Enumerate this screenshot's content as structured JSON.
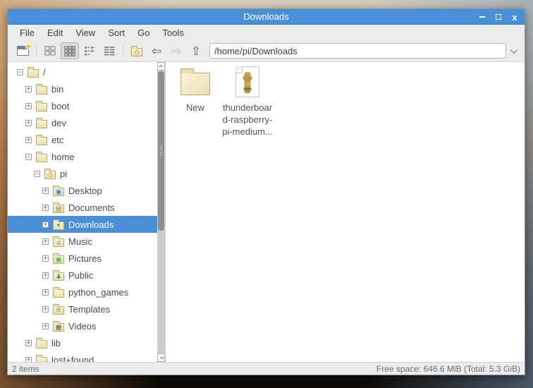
{
  "window": {
    "title": "Downloads",
    "controls": {
      "minimize": "minimize",
      "maximize": "maximize",
      "close": "x"
    }
  },
  "menu_bar": {
    "items": [
      "File",
      "Edit",
      "View",
      "Sort",
      "Go",
      "Tools"
    ]
  },
  "toolbar": {
    "buttons": [
      "new-window",
      "icon-view",
      "thumbnail-view",
      "compact-view",
      "detailed-list-view",
      "home",
      "back",
      "forward",
      "up"
    ],
    "active_view": "thumbnail-view",
    "back_glyph": "⇦",
    "forward_glyph": "⇨",
    "up_glyph": "⇧",
    "home_overlay_glyph": "⌂",
    "path": {
      "value": "/home/pi/Downloads"
    }
  },
  "sidebar": {
    "tree": [
      {
        "label": "/",
        "level": 0,
        "expander": "−",
        "icon": "folder",
        "glyph": ""
      },
      {
        "label": "bin",
        "level": 1,
        "expander": "+",
        "icon": "folder",
        "glyph": ""
      },
      {
        "label": "boot",
        "level": 1,
        "expander": "+",
        "icon": "folder",
        "glyph": ""
      },
      {
        "label": "dev",
        "level": 1,
        "expander": "+",
        "icon": "folder",
        "glyph": ""
      },
      {
        "label": "etc",
        "level": 1,
        "expander": "+",
        "icon": "folder",
        "glyph": ""
      },
      {
        "label": "home",
        "level": 1,
        "expander": "−",
        "icon": "folder",
        "glyph": ""
      },
      {
        "label": "pi",
        "level": 2,
        "expander": "−",
        "icon": "home-folder",
        "glyph": "⌂"
      },
      {
        "label": "Desktop",
        "level": 3,
        "expander": "+",
        "icon": "desktop-folder",
        "glyph": "▣"
      },
      {
        "label": "Documents",
        "level": 3,
        "expander": "+",
        "icon": "documents-folder",
        "glyph": "▤"
      },
      {
        "label": "Downloads",
        "level": 3,
        "expander": "+",
        "icon": "downloads-folder",
        "glyph": "▼",
        "selected": true
      },
      {
        "label": "Music",
        "level": 3,
        "expander": "+",
        "icon": "music-folder",
        "glyph": "♫"
      },
      {
        "label": "Pictures",
        "level": 3,
        "expander": "+",
        "icon": "pictures-folder",
        "glyph": "▣"
      },
      {
        "label": "Public",
        "level": 3,
        "expander": "+",
        "icon": "public-folder",
        "glyph": "♟"
      },
      {
        "label": "python_games",
        "level": 3,
        "expander": "+",
        "icon": "folder",
        "glyph": ""
      },
      {
        "label": "Templates",
        "level": 3,
        "expander": "+",
        "icon": "templates-folder",
        "glyph": "≡"
      },
      {
        "label": "Videos",
        "level": 3,
        "expander": "+",
        "icon": "videos-folder",
        "glyph": "▦"
      },
      {
        "label": "lib",
        "level": 1,
        "expander": "+",
        "icon": "folder",
        "glyph": ""
      },
      {
        "label": "lost+found",
        "level": 1,
        "expander": "+",
        "icon": "folder",
        "glyph": ""
      }
    ]
  },
  "main": {
    "items": [
      {
        "label": "New",
        "icon": "folder"
      },
      {
        "label": "thunderboar\nd-raspberry-\npi-medium...",
        "icon": "image-file"
      }
    ]
  },
  "status_bar": {
    "left": "2 items",
    "right": "Free space: 646.6 MiB (Total: 5.3 GiB)"
  },
  "colors": {
    "titlebar": "#4a90d9",
    "selection": "#4a90d9",
    "chrome_bg": "#ececec",
    "pane_bg": "#ffffff",
    "folder_fill": "#eadfae",
    "folder_border": "#b9a869"
  }
}
